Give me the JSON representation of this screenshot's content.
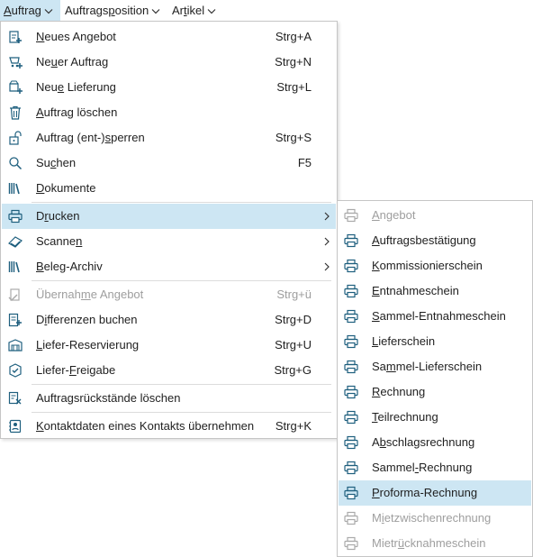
{
  "colors": {
    "accent": "#1e5f7e",
    "highlight": "#cde6f3",
    "disabled": "#9e9e9e"
  },
  "menubar": [
    {
      "pre": "",
      "key": "A",
      "post": "uftrag"
    },
    {
      "pre": "Auftrags",
      "key": "p",
      "post": "osition"
    },
    {
      "pre": "Ar",
      "key": "t",
      "post": "ikel"
    }
  ],
  "menu": {
    "items": [
      {
        "pre": "",
        "key": "N",
        "post": "eues Angebot",
        "shortcut": "Strg+A",
        "icon": "new-offer-icon"
      },
      {
        "pre": "Ne",
        "key": "u",
        "post": "er Auftrag",
        "shortcut": "Strg+N",
        "icon": "new-order-icon"
      },
      {
        "pre": "Neu",
        "key": "e",
        "post": " Lieferung",
        "shortcut": "Strg+L",
        "icon": "new-delivery-icon"
      },
      {
        "pre": "",
        "key": "A",
        "post": "uftrag löschen",
        "shortcut": "",
        "icon": "trash-icon"
      },
      {
        "pre": "Auftrag (ent-)",
        "key": "s",
        "post": "perren",
        "shortcut": "Strg+S",
        "icon": "lock-icon"
      },
      {
        "pre": "Su",
        "key": "c",
        "post": "hen",
        "shortcut": "F5",
        "icon": "search-icon"
      },
      {
        "pre": "",
        "key": "D",
        "post": "okumente",
        "shortcut": "",
        "icon": "documents-icon"
      },
      {
        "pre": "D",
        "key": "r",
        "post": "ucken",
        "shortcut": "",
        "icon": "printer-icon"
      },
      {
        "pre": "Scanne",
        "key": "n",
        "post": "",
        "shortcut": "",
        "icon": "scanner-icon"
      },
      {
        "pre": "",
        "key": "B",
        "post": "eleg-Archiv",
        "shortcut": "",
        "icon": "archive-icon"
      },
      {
        "pre": "Übernah",
        "key": "m",
        "post": "e Angebot",
        "shortcut": "Strg+ü",
        "icon": "take-over-offer-icon"
      },
      {
        "pre": "D",
        "key": "i",
        "post": "fferenzen buchen",
        "shortcut": "Strg+D",
        "icon": "book-differences-icon"
      },
      {
        "pre": "",
        "key": "L",
        "post": "iefer-Reservierung",
        "shortcut": "Strg+U",
        "icon": "delivery-reservation-icon"
      },
      {
        "pre": "Liefer-",
        "key": "F",
        "post": "reigabe",
        "shortcut": "Strg+G",
        "icon": "delivery-release-icon"
      },
      {
        "pre": "Auftragsrückstände löschen",
        "key": "",
        "post": "",
        "shortcut": "",
        "icon": "clear-backlog-icon"
      },
      {
        "pre": "",
        "key": "K",
        "post": "ontaktdaten eines Kontakts übernehmen",
        "shortcut": "Strg+K",
        "icon": "contact-card-icon"
      }
    ]
  },
  "submenu": {
    "items": [
      {
        "pre": "",
        "key": "A",
        "post": "ngebot"
      },
      {
        "pre": "",
        "key": "A",
        "post": "uftragsbestätigung"
      },
      {
        "pre": "",
        "key": "K",
        "post": "ommissionierschein"
      },
      {
        "pre": "",
        "key": "E",
        "post": "ntnahmeschein"
      },
      {
        "pre": "",
        "key": "S",
        "post": "ammel-Entnahmeschein"
      },
      {
        "pre": "",
        "key": "L",
        "post": "ieferschein"
      },
      {
        "pre": "Sa",
        "key": "m",
        "post": "mel-Lieferschein"
      },
      {
        "pre": "",
        "key": "R",
        "post": "echnung"
      },
      {
        "pre": "",
        "key": "T",
        "post": "eilrechnung"
      },
      {
        "pre": "A",
        "key": "b",
        "post": "schlagsrechnung"
      },
      {
        "pre": "Sammel",
        "key": "-",
        "post": "Rechnung"
      },
      {
        "pre": "",
        "key": "P",
        "post": "roforma-Rechnung"
      },
      {
        "pre": "M",
        "key": "i",
        "post": "etzwischenrechnung"
      },
      {
        "pre": "Mietr",
        "key": "ü",
        "post": "cknahmeschein"
      }
    ]
  }
}
